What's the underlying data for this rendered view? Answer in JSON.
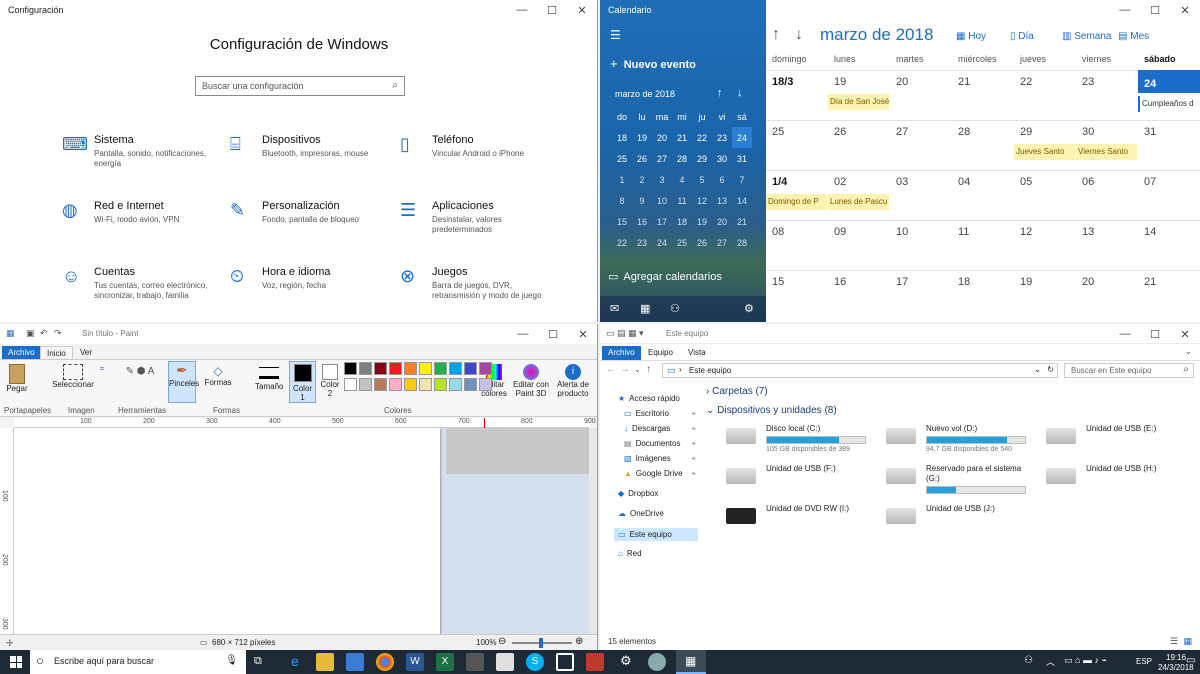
{
  "settings": {
    "window_title": "Configuración",
    "heading": "Configuración de Windows",
    "search_placeholder": "Buscar una configuración",
    "tiles": [
      {
        "title": "Sistema",
        "subtitle": "Pantalla, sonido, notificaciones, energía",
        "icon": "laptop-icon"
      },
      {
        "title": "Dispositivos",
        "subtitle": "Bluetooth, impresoras, mouse",
        "icon": "devices-icon"
      },
      {
        "title": "Teléfono",
        "subtitle": "Vincular Android o iPhone",
        "icon": "phone-icon"
      },
      {
        "title": "Red e Internet",
        "subtitle": "Wi-Fi, modo avión, VPN",
        "icon": "globe-icon"
      },
      {
        "title": "Personalización",
        "subtitle": "Fondo, pantalla de bloqueo",
        "icon": "personalization-icon"
      },
      {
        "title": "Aplicaciones",
        "subtitle": "Desinstalar, valores predeterminados",
        "icon": "apps-list-icon"
      },
      {
        "title": "Cuentas",
        "subtitle": "Tus cuentas, correo electrónico, sincronizar, trabajo, familia",
        "icon": "person-icon"
      },
      {
        "title": "Hora e idioma",
        "subtitle": "Voz, región, fecha",
        "icon": "time-language-icon"
      },
      {
        "title": "Juegos",
        "subtitle": "Barra de juegos, DVR, retransmisión y modo de juego",
        "icon": "xbox-icon"
      }
    ]
  },
  "calendar": {
    "window_title": "Calendario",
    "new_event": "Nuevo evento",
    "mini_month": "marzo de 2018",
    "mini_weekdays": [
      "do",
      "lu",
      "ma",
      "mi",
      "ju",
      "vi",
      "sá"
    ],
    "mini_days": [
      "18",
      "19",
      "20",
      "21",
      "22",
      "23",
      "24",
      "25",
      "26",
      "27",
      "28",
      "29",
      "30",
      "31",
      "1",
      "2",
      "3",
      "4",
      "5",
      "6",
      "7",
      "8",
      "9",
      "10",
      "11",
      "12",
      "13",
      "14",
      "15",
      "16",
      "17",
      "18",
      "19",
      "20",
      "21",
      "22",
      "23",
      "24",
      "25",
      "26",
      "27",
      "28"
    ],
    "add_calendars": "Agregar calendarios",
    "month_title": "marzo de 2018",
    "today_label": "Hoy",
    "day_label": "Día",
    "week_label": "Semana",
    "month_label": "Mes",
    "weekdays": [
      "domingo",
      "lunes",
      "martes",
      "miércoles",
      "jueves",
      "viernes",
      "sábado"
    ],
    "weeks": [
      [
        "18/3",
        "19",
        "20",
        "21",
        "22",
        "23",
        "24"
      ],
      [
        "25",
        "26",
        "27",
        "28",
        "29",
        "30",
        "31"
      ],
      [
        "1/4",
        "02",
        "03",
        "04",
        "05",
        "06",
        "07"
      ],
      [
        "08",
        "09",
        "10",
        "11",
        "12",
        "13",
        "14"
      ],
      [
        "15",
        "16",
        "17",
        "18",
        "19",
        "20",
        "21"
      ]
    ],
    "events": [
      {
        "week": 0,
        "day": 1,
        "text": "Día de San José"
      },
      {
        "week": 0,
        "day": 6,
        "text": "Cumpleaños d"
      },
      {
        "week": 1,
        "day": 4,
        "text": "Jueves Santo"
      },
      {
        "week": 1,
        "day": 5,
        "text": "Viernes Santo"
      },
      {
        "week": 2,
        "day": 0,
        "text": "Domingo de P"
      },
      {
        "week": 2,
        "day": 1,
        "text": "Lunes de Pascu"
      }
    ]
  },
  "paint": {
    "window_title": "Sin título - Paint",
    "tabs": [
      "Archivo",
      "Inicio",
      "Ver"
    ],
    "buttons": {
      "paste": "Pegar",
      "select": "Seleccionar",
      "brushes": "Pinceles",
      "shapes": "Formas",
      "size": "Tamaño",
      "color1": "Color 1",
      "color2": "Color 2",
      "edit_colors": "Editar colores",
      "edit_3d": "Editar con Paint 3D",
      "alert": "Alerta de producto"
    },
    "groups": [
      "Portapapeles",
      "Imagen",
      "Herramientas",
      "Formas",
      "Colores"
    ],
    "ruler": [
      "100",
      "200",
      "300",
      "400",
      "500",
      "600",
      "700",
      "800",
      "900"
    ],
    "vruler": [
      "100",
      "200",
      "300"
    ],
    "status_size": "680 × 712 píxeles",
    "zoom": "100%",
    "palette": [
      "#000000",
      "#7f7f7f",
      "#880015",
      "#ed1c24",
      "#ff7f27",
      "#fff200",
      "#22b14c",
      "#00a2e8",
      "#3f48cc",
      "#a349a4",
      "#ffffff",
      "#c3c3c3",
      "#b97a57",
      "#ffaec9",
      "#ffc90e",
      "#efe4b0",
      "#b5e61d",
      "#99d9ea",
      "#7092be",
      "#c8bfe7"
    ]
  },
  "explorer": {
    "window_title": "Este equipo",
    "tabs": [
      "Archivo",
      "Equipo",
      "Vista"
    ],
    "address": "Este equipo",
    "search_placeholder": "Buscar en Este equipo",
    "nav": [
      "Acceso rápido",
      "Escritorio",
      "Descargas",
      "Documentos",
      "Imágenes",
      "Google Drive",
      "Dropbox",
      "OneDrive",
      "Este equipo",
      "Red"
    ],
    "folders_header": "Carpetas (7)",
    "devices_header": "Dispositivos y unidades (8)",
    "drives": [
      {
        "name": "Disco local (C:)",
        "cap": "105 GB disponibles de 389",
        "fill": 0.73
      },
      {
        "name": "Nuevo vol (D:)",
        "cap": "94,7 GB disponibles de 540",
        "fill": 0.82
      },
      {
        "name": "Unidad de USB (E:)"
      },
      {
        "name": "Unidad de USB (F:)"
      },
      {
        "name": "Reservado para el sistema (G:)",
        "fill": 0.3
      },
      {
        "name": "Unidad de USB (H:)"
      },
      {
        "name": "Unidad de DVD RW (I:)"
      },
      {
        "name": "Unidad de USB (J:)"
      }
    ],
    "status": "15 elementos"
  },
  "taskbar": {
    "search": "Escribe aquí para buscar",
    "lang": "ESP",
    "time": "19:16",
    "date": "24/3/2018"
  }
}
